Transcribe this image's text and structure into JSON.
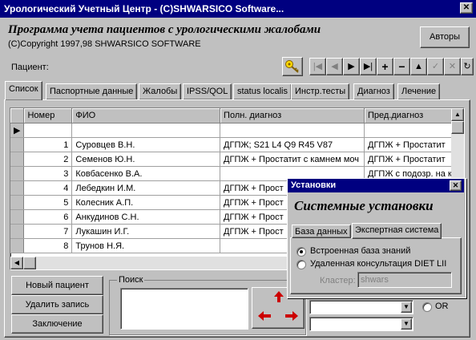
{
  "window": {
    "title": "Урологический Учетный Центр - (С)SHWARSICO Software..."
  },
  "header": {
    "heading": "Программа учета пациентов с урологическими жалобами",
    "copyright": "(C)Copyright 1997,98 SHWARSICO SOFTWARE",
    "authors_button": "Авторы"
  },
  "patient_label": "Пациент:",
  "tabs": [
    "Список",
    "Паспортные данные",
    "Жалобы",
    "IPSS/QOL",
    "status localis",
    "Инстр.тесты",
    "Диагноз",
    "Лечение"
  ],
  "grid": {
    "columns": [
      "Номер",
      "ФИО",
      "Полн. диагноз",
      "Пред.диагноз"
    ],
    "rows": [
      [
        "",
        "",
        "",
        ""
      ],
      [
        "1",
        "Суровцев В.Н.",
        "ДГПЖ; S21 L4 Q9 R45 V87",
        "ДГПЖ + Простатит"
      ],
      [
        "2",
        "Семенов Ю.Н.",
        "ДГПЖ + Простатит с камнем моч",
        "ДГПЖ + Простатит"
      ],
      [
        "3",
        "Ковбасенко В.А.",
        "",
        "ДГПЖ с подозр. на к"
      ],
      [
        "4",
        "Лебедкин И.М.",
        "ДГПЖ + Прост",
        ""
      ],
      [
        "5",
        "Колесник А.П.",
        "ДГПЖ + Прост",
        ""
      ],
      [
        "6",
        "Анкудинов С.Н.",
        "ДГПЖ + Прост",
        ""
      ],
      [
        "7",
        "Лукашин И.Г.",
        "ДГПЖ + Прост",
        ""
      ],
      [
        "8",
        "Трунов Н.Я.",
        "",
        ""
      ]
    ]
  },
  "buttons": {
    "new_patient": "Новый пациент",
    "delete_record": "Удалить запись",
    "conclusion": "Заключение"
  },
  "search": {
    "label": "Поиск",
    "or_label": "OR"
  },
  "dialog": {
    "title": "Установки",
    "heading": "Системные установки",
    "tabs": [
      "База данных",
      "Экспертная система"
    ],
    "option_builtin": "Встроенная база знаний",
    "option_remote": "Удаленная консультация DIET LII",
    "cluster_label": "Кластер:",
    "cluster_value": "shwars"
  },
  "colors": {
    "titlebar": "#000080",
    "face": "#c0c0c0",
    "arrow_red": "#cc0000"
  }
}
